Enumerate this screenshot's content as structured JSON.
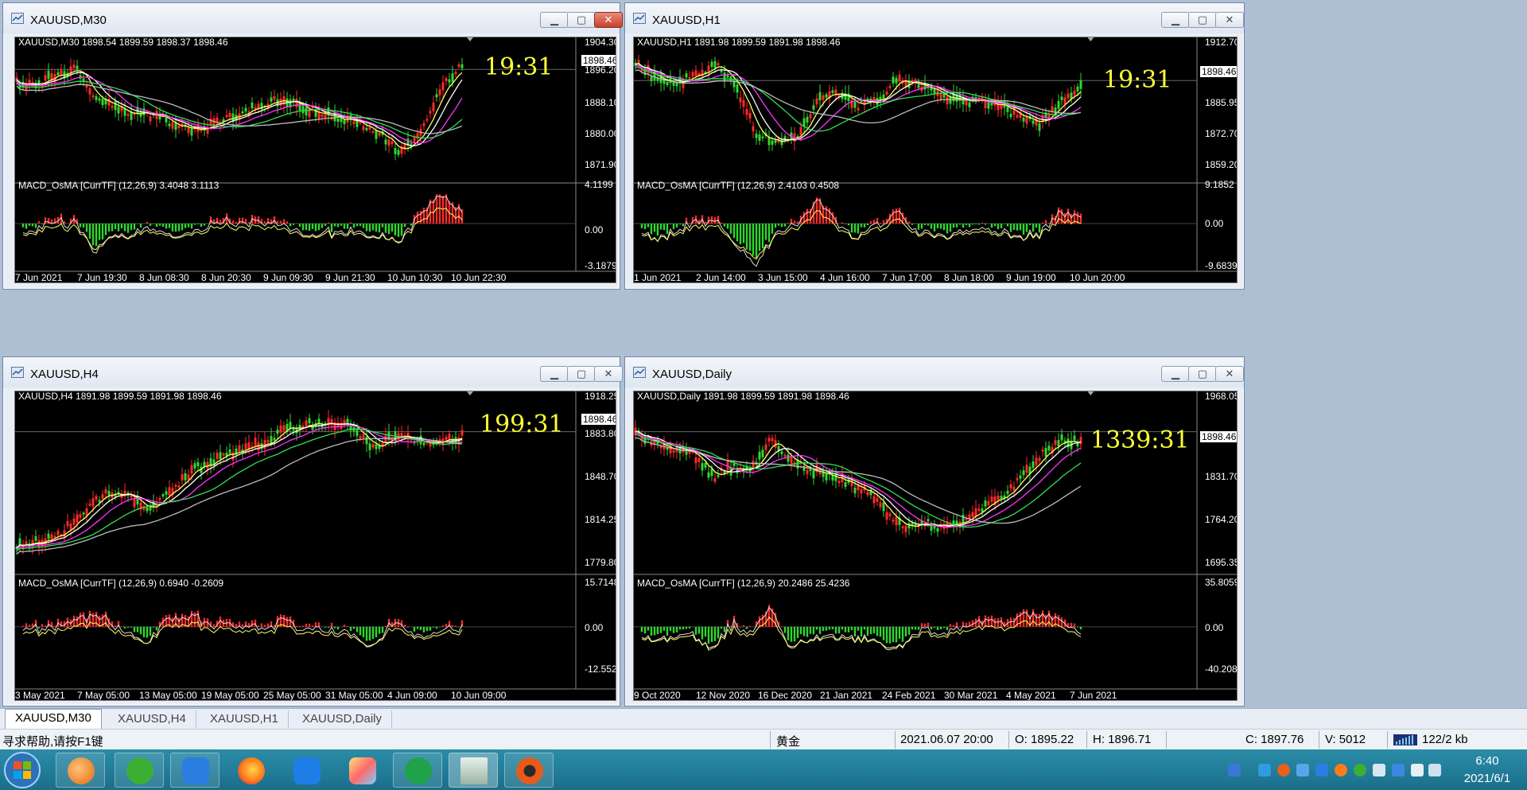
{
  "windows": [
    {
      "title": "XAUUSD,M30",
      "header": "XAUUSD,M30  1898.54 1899.59 1898.37 1898.46",
      "countdown": "19:31",
      "price_tag": "1898.46",
      "price_labels": [
        "1904.30",
        "1896.20",
        "1888.10",
        "1880.00",
        "1871.90"
      ],
      "macd_header": "MACD_OsMA [CurrTF] (12,26,9) 3.4048 3.1113",
      "macd_labels": [
        "4.1199",
        "0.00",
        "-3.1879"
      ],
      "time_labels": [
        "7 Jun 2021",
        "7 Jun 19:30",
        "8 Jun 08:30",
        "8 Jun 20:30",
        "9 Jun 09:30",
        "9 Jun 21:30",
        "10 Jun 10:30",
        "10 Jun 22:30"
      ]
    },
    {
      "title": "XAUUSD,H1",
      "header": "XAUUSD,H1  1891.98 1899.59 1891.98 1898.46",
      "countdown": "19:31",
      "price_tag": "1898.46",
      "price_labels": [
        "1912.70",
        "1898.46",
        "1885.95",
        "1872.70",
        "1859.20"
      ],
      "macd_header": "MACD_OsMA [CurrTF] (12,26,9) 2.4103 0.4508",
      "macd_labels": [
        "9.1852",
        "0.00",
        "-9.6839"
      ],
      "time_labels": [
        "1 Jun 2021",
        "2 Jun 14:00",
        "3 Jun 15:00",
        "4 Jun 16:00",
        "7 Jun 17:00",
        "8 Jun 18:00",
        "9 Jun 19:00",
        "10 Jun 20:00"
      ]
    },
    {
      "title": "XAUUSD,H4",
      "header": "XAUUSD,H4  1891.98 1899.59 1891.98 1898.46",
      "countdown": "199:31",
      "price_tag": "1898.46",
      "price_labels": [
        "1918.25",
        "1883.80",
        "1848.70",
        "1814.25",
        "1779.80"
      ],
      "macd_header": "MACD_OsMA [CurrTF] (12,26,9) 0.6940 -0.2609",
      "macd_labels": [
        "15.7148",
        "0.00",
        "-12.5521"
      ],
      "time_labels": [
        "3 May 2021",
        "7 May 05:00",
        "13 May 05:00",
        "19 May 05:00",
        "25 May 05:00",
        "31 May 05:00",
        "4 Jun 09:00",
        "10 Jun 09:00"
      ]
    },
    {
      "title": "XAUUSD,Daily",
      "header": "XAUUSD,Daily  1891.98 1899.59 1891.98 1898.46",
      "countdown": "1339:31",
      "price_tag": "1898.46",
      "price_labels": [
        "1968.05",
        "1831.70",
        "1764.20",
        "1695.35"
      ],
      "macd_header": "MACD_OsMA [CurrTF] (12,26,9) 20.2486 25.4236",
      "macd_labels": [
        "35.8059",
        "0.00",
        "-40.2082"
      ],
      "time_labels": [
        "9 Oct 2020",
        "12 Nov 2020",
        "16 Dec 2020",
        "21 Jan 2021",
        "24 Feb 2021",
        "30 Mar 2021",
        "4 May 2021",
        "7 Jun 2021"
      ]
    }
  ],
  "tabs": [
    "XAUUSD,M30",
    "XAUUSD,H4",
    "XAUUSD,H1",
    "XAUUSD,Daily"
  ],
  "active_tab": 0,
  "status": {
    "help": "寻求帮助,请按F1键",
    "symbol": "黄金",
    "datetime": "2021.06.07 20:00",
    "open": "O: 1895.22",
    "high": "H: 1896.71",
    "close": "C: 1897.76",
    "volume": "V: 5012",
    "traffic": "122/2 kb"
  },
  "taskbar": {
    "time": "6:40",
    "date": "2021/6/1"
  },
  "colors": {
    "bull": "#ff2a2a",
    "bear": "#2fd82f",
    "countdown": "#ffff33",
    "ma_yellow": "#ffff66",
    "ma_magenta": "#ff33ff",
    "ma_green": "#33dd55",
    "ma_gray": "#bbbbbb"
  }
}
